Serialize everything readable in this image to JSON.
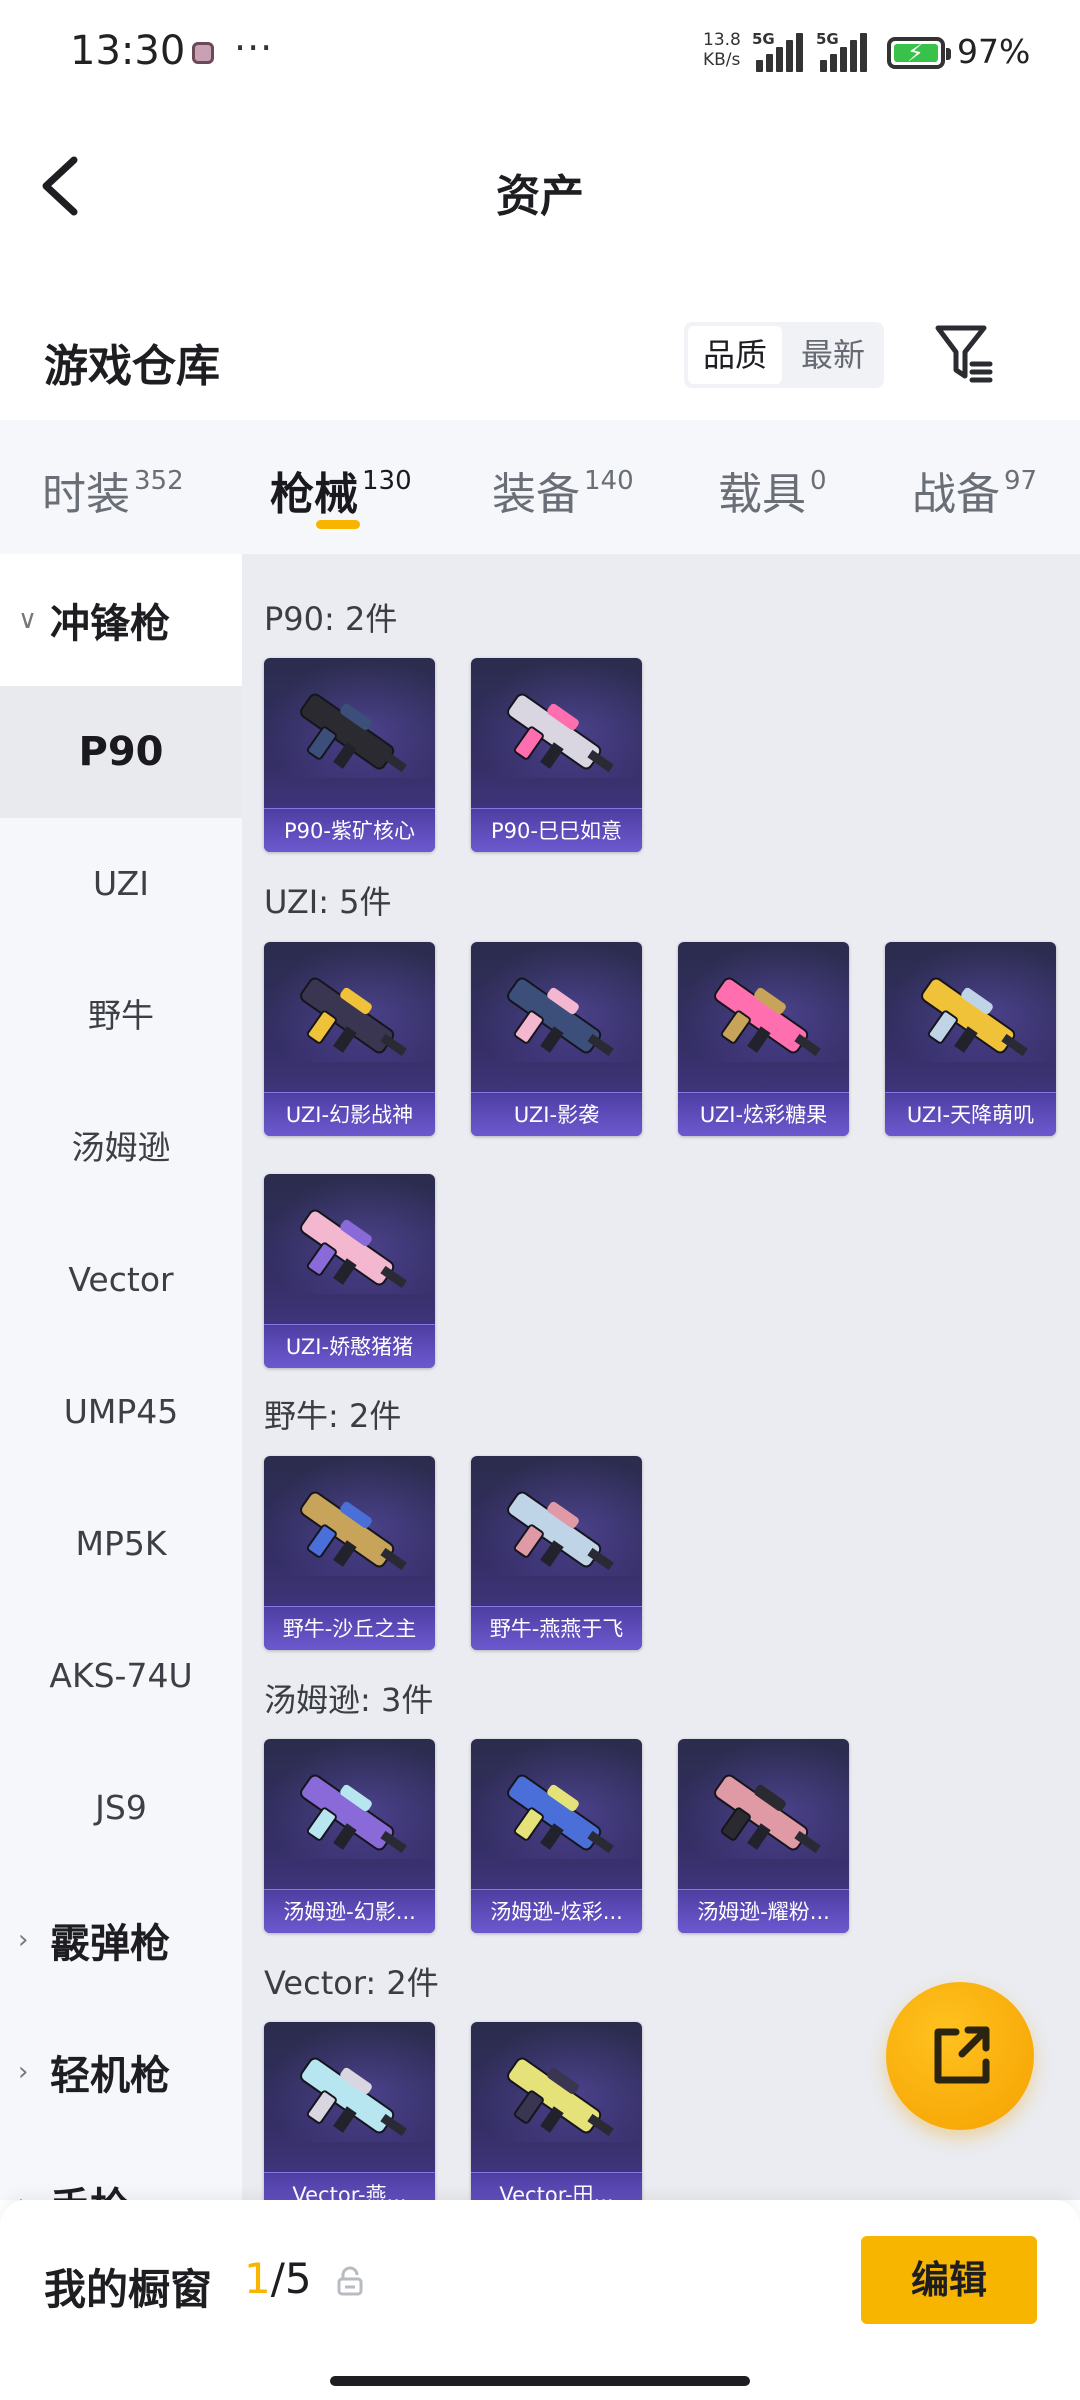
{
  "status_bar": {
    "time": "13:30",
    "speed_value": "13.8",
    "speed_unit": "KB/s",
    "signal1": "5G",
    "signal2": "5G",
    "battery": "97%"
  },
  "header": {
    "title": "资产"
  },
  "warehouse": {
    "title": "游戏仓库",
    "sort_quality": "品质",
    "sort_newest": "最新"
  },
  "categories": [
    {
      "name": "时装",
      "count": "352"
    },
    {
      "name": "枪械",
      "count": "130"
    },
    {
      "name": "装备",
      "count": "140"
    },
    {
      "name": "载具",
      "count": "0"
    },
    {
      "name": "战备",
      "count": "97"
    }
  ],
  "sidebar": {
    "group_smg": "冲锋枪",
    "items": [
      "P90",
      "UZI",
      "野牛",
      "汤姆逊",
      "Vector",
      "UMP45",
      "MP5K",
      "AKS-74U",
      "JS9"
    ],
    "group_shotgun": "霰弹枪",
    "group_lmg": "轻机枪",
    "group_pistol": "手枪"
  },
  "sections": [
    {
      "title": "P90: 2件",
      "items": [
        "P90-紫矿核心",
        "P90-巳巳如意"
      ]
    },
    {
      "title": "UZI: 5件",
      "items": [
        "UZI-幻影战神",
        "UZI-影袭",
        "UZI-炫彩糖果",
        "UZI-天降萌叽",
        "UZI-娇憨猪猪"
      ]
    },
    {
      "title": "野牛: 2件",
      "items": [
        "野牛-沙丘之主",
        "野牛-燕燕于飞"
      ]
    },
    {
      "title": "汤姆逊: 3件",
      "items": [
        "汤姆逊-幻影...",
        "汤姆逊-炫彩...",
        "汤姆逊-耀粉..."
      ]
    },
    {
      "title": "Vector: 2件",
      "items": [
        "Vector-燕...",
        "Vector-田..."
      ]
    }
  ],
  "showcase": {
    "title": "我的橱窗",
    "current": "1",
    "total": "/5",
    "edit_label": "编辑"
  },
  "icons": {
    "back": "chevron-left-icon",
    "filter": "filter-icon",
    "share": "share-external-icon",
    "lock": "lock-icon"
  },
  "colors": {
    "accent": "#f7b500",
    "card_top": "#2b2c4d",
    "card_bottom": "#473a8f",
    "gun_colors": [
      "#2a2a30",
      "#d9d6e2",
      "#3a3550",
      "#3c4f7a",
      "#ff6fb0",
      "#f0c23a",
      "#f4b7d0",
      "#c8a35a",
      "#c0d4e8",
      "#8a6ad8",
      "#4a6fd8",
      "#e09aa5",
      "#b8e6f0",
      "#e6e27a"
    ]
  }
}
